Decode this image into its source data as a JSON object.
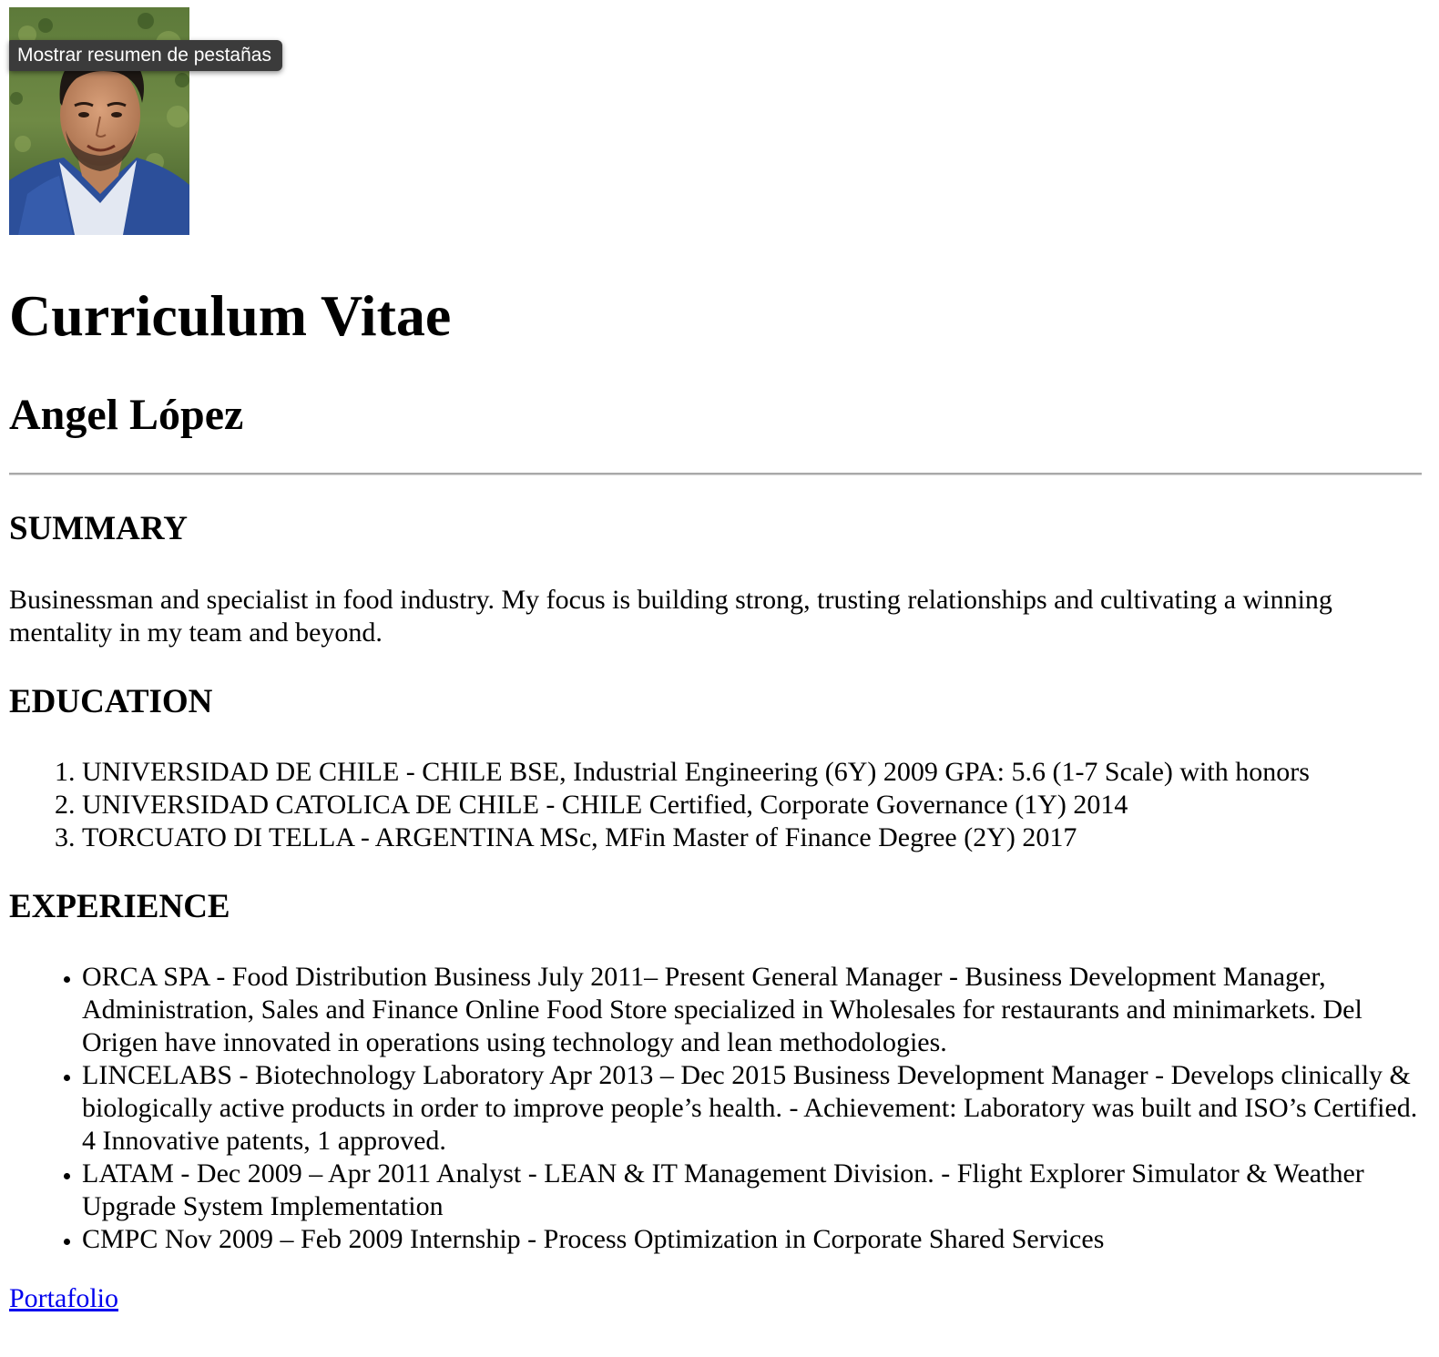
{
  "tooltip": {
    "text": "Mostrar resumen de pestañas"
  },
  "header": {
    "title": "Curriculum Vitae",
    "name": "Angel López"
  },
  "summary": {
    "heading": "SUMMARY",
    "text": "Businessman and specialist in food industry. My focus is building strong, trusting relationships and cultivating a winning mentality in my team and beyond."
  },
  "education": {
    "heading": "EDUCATION",
    "items": [
      "UNIVERSIDAD DE CHILE - CHILE BSE, Industrial Engineering (6Y) 2009 GPA: 5.6 (1-7 Scale) with honors",
      "UNIVERSIDAD CATOLICA DE CHILE - CHILE Certified, Corporate Governance (1Y) 2014",
      "TORCUATO DI TELLA - ARGENTINA MSc, MFin Master of Finance Degree (2Y) 2017"
    ]
  },
  "experience": {
    "heading": "EXPERIENCE",
    "items": [
      "ORCA SPA - Food Distribution Business July 2011– Present General Manager - Business Development Manager, Administration, Sales and Finance Online Food Store specialized in Wholesales for restaurants and minimarkets. Del Origen have innovated in operations using technology and lean methodologies.",
      "LINCELABS - Biotechnology Laboratory Apr 2013 – Dec 2015 Business Development Manager - Develops clinically & biologically active products in order to improve people’s health. - Achievement: Laboratory was built and ISO’s Certified. 4 Innovative patents, 1 approved.",
      "LATAM - Dec 2009 – Apr 2011 Analyst - LEAN & IT Management Division. - Flight Explorer Simulator & Weather Upgrade System Implementation",
      "CMPC Nov 2009 – Feb 2009 Internship - Process Optimization in Corporate Shared Services"
    ]
  },
  "footer": {
    "portfolio_link": "Portafolio"
  },
  "colors": {
    "link": "#0000ee",
    "tooltip_bg": "#3b3b3b",
    "rule": "#a9a9a9"
  }
}
